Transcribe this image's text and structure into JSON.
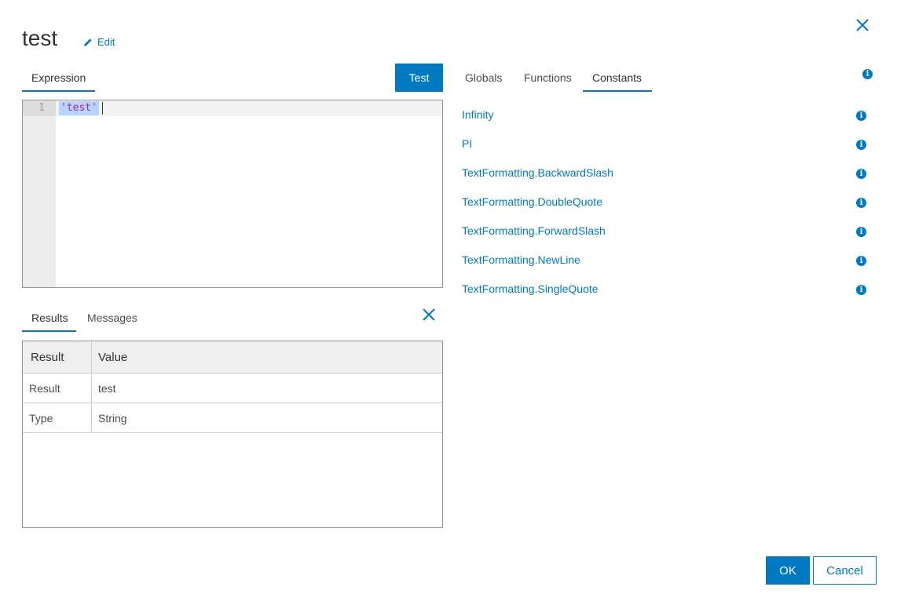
{
  "header": {
    "title": "test",
    "edit_label": "Edit"
  },
  "left_tabs": {
    "expression": "Expression",
    "test_button": "Test"
  },
  "editor": {
    "line_number": "1",
    "code": "'test'"
  },
  "results_tabs": {
    "results": "Results",
    "messages": "Messages"
  },
  "results_table": {
    "headers": [
      "Result",
      "Value"
    ],
    "rows": [
      [
        "Result",
        "test"
      ],
      [
        "Type",
        "String"
      ]
    ]
  },
  "right_tabs": {
    "globals": "Globals",
    "functions": "Functions",
    "constants": "Constants",
    "active": "Constants"
  },
  "constants": [
    "Infinity",
    "PI",
    "TextFormatting.BackwardSlash",
    "TextFormatting.DoubleQuote",
    "TextFormatting.ForwardSlash",
    "TextFormatting.NewLine",
    "TextFormatting.SingleQuote"
  ],
  "footer": {
    "ok_label": "OK",
    "cancel_label": "Cancel"
  },
  "icons": {
    "info": "info-icon",
    "close": "close-icon",
    "edit": "pencil-icon"
  },
  "colors": {
    "accent": "#0079c1",
    "selection": "#b5d5ff",
    "string_token": "#a626a4"
  }
}
